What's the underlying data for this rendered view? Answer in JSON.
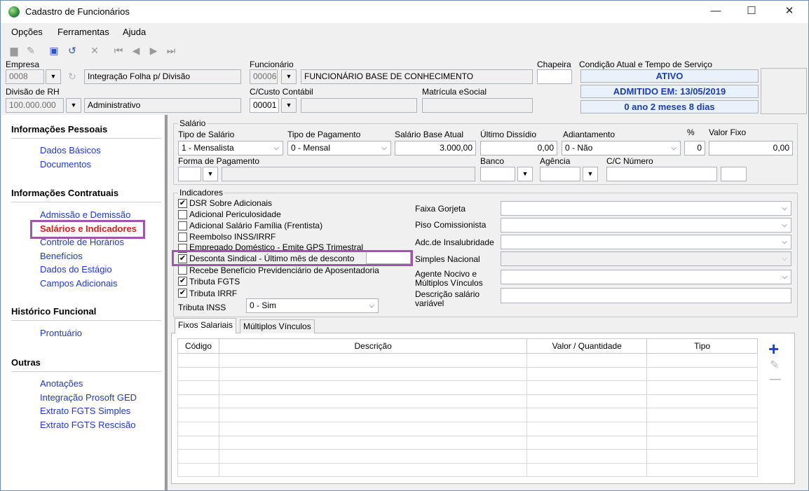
{
  "window": {
    "title": "Cadastro de Funcionários",
    "minimize": "—",
    "maximize": "☐",
    "close": "✕"
  },
  "menu": [
    "Opções",
    "Ferramentas",
    "Ajuda"
  ],
  "toolbar": {
    "icons": [
      "new-icon",
      "edit-icon",
      "save-icon",
      "undo-icon",
      "delete-icon",
      "first-icon",
      "prev-icon",
      "next-icon",
      "last-icon"
    ]
  },
  "header": {
    "empresa_label": "Empresa",
    "empresa_code": "0008",
    "empresa_name": "Integração Folha p/ Divisão",
    "divisao_label": "Divisão de RH",
    "divisao_code": "100.000.000",
    "divisao_name": "Administrativo",
    "funcionario_label": "Funcionário",
    "funcionario_code": "00006",
    "funcionario_name": "FUNCIONÁRIO BASE DE CONHECIMENTO",
    "custo_label": "C/Custo Contábil",
    "custo_code": "00001",
    "custo_name": "",
    "matricula_label": "Matrícula eSocial",
    "matricula_value": "",
    "chapeira_label": "Chapeira",
    "chapeira_value": "",
    "condicao_label": "Condição Atual e Tempo de Serviço",
    "status_1": "ATIVO",
    "status_2": "ADMITIDO EM: 13/05/2019",
    "status_3": "0 ano 2 meses 8 dias"
  },
  "sidebar": {
    "sections": [
      {
        "title": "Informações Pessoais",
        "items": [
          "Dados Básicos",
          "Documentos"
        ]
      },
      {
        "title": "Informações Contratuais",
        "items": [
          "Admissão e Demissão",
          "Salários e Indicadores",
          "Controle de Horários",
          "Benefícios",
          "Dados do Estágio",
          "Campos Adicionais"
        ]
      },
      {
        "title": "Histórico Funcional",
        "items": [
          "Prontuário"
        ]
      },
      {
        "title": "Outras",
        "items": [
          "Anotações",
          "Integração Prosoft GED",
          "Extrato FGTS Simples",
          "Extrato FGTS Rescisão"
        ]
      }
    ],
    "active": "Salários e Indicadores"
  },
  "salario": {
    "group_title": "Salário",
    "tipo_salario_label": "Tipo de Salário",
    "tipo_salario": "1 - Mensalista",
    "tipo_pagamento_label": "Tipo de Pagamento",
    "tipo_pagamento": "0 - Mensal",
    "salario_base_label": "Salário Base Atual",
    "salario_base": "3.000,00",
    "ultimo_dissidio_label": "Último Dissídio",
    "ultimo_dissidio": "0,00",
    "adiantamento_label": "Adiantamento",
    "adiantamento": "0 - Não",
    "percent_label": "%",
    "percent": "0",
    "valor_fixo_label": "Valor Fixo",
    "valor_fixo": "0,00",
    "forma_pagamento_label": "Forma de Pagamento",
    "banco_label": "Banco",
    "agencia_label": "Agência",
    "cc_label": "C/C Número"
  },
  "indicadores": {
    "group_title": "Indicadores",
    "checks": [
      {
        "label": "DSR Sobre Adicionais",
        "checked": true
      },
      {
        "label": "Adicional Periculosidade",
        "checked": false
      },
      {
        "label": "Adicional Salário Família (Frentista)",
        "checked": false
      },
      {
        "label": "Reembolso INSS/IRRF",
        "checked": false
      },
      {
        "label": "Empregado Doméstico - Emite GPS Trimestral",
        "checked": false
      },
      {
        "label": "Desconta Sindical - Último mês de desconto",
        "checked": true
      },
      {
        "label": "Recebe Benefício Previdenciário de Aposentadoria",
        "checked": false
      },
      {
        "label": "Tributa FGTS",
        "checked": true
      },
      {
        "label": "Tributa IRRF",
        "checked": true
      }
    ],
    "tributa_inss_label": "Tributa INSS",
    "tributa_inss": "0 - Sim",
    "faixa_gorjeta": "Faixa Gorjeta",
    "piso_comissionista": "Piso Comissionista",
    "adc_insalubridade": "Adc.de Insalubridade",
    "simples_nacional": "Simples Nacional",
    "agente_nocivo_1": "Agente Nocivo e",
    "agente_nocivo_2": "Múltiplos Vínculos",
    "descricao_salario_1": "Descrição salário",
    "descricao_salario_2": "variável"
  },
  "tabs": [
    "Fixos Salariais",
    "Múltiplos Vínculos"
  ],
  "grid": {
    "columns": [
      "Código",
      "Descrição",
      "Valor / Quantidade",
      "Tipo"
    ],
    "rows": 9
  },
  "side_actions": {
    "add": "+",
    "edit": "✎",
    "remove": "—"
  },
  "colors": {
    "link": "#1e39c6",
    "active_link": "#e0191b",
    "status_text": "#1a3db3",
    "highlight": "#9b59a8"
  }
}
